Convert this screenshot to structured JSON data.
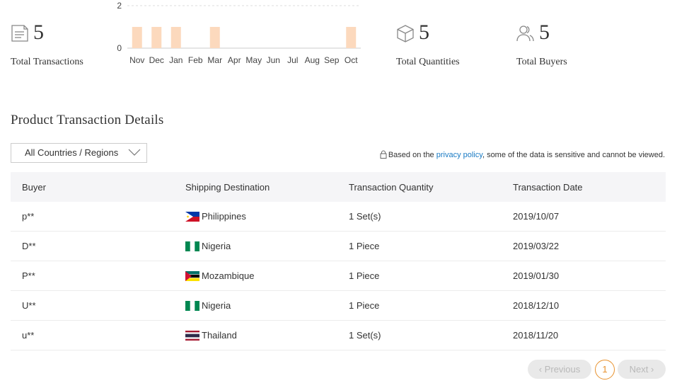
{
  "stats": {
    "transactions": {
      "value": "5",
      "label": "Total Transactions",
      "icon": "document-icon"
    },
    "quantities": {
      "value": "5",
      "label": "Total Quantities",
      "icon": "box-icon"
    },
    "buyers": {
      "value": "5",
      "label": "Total Buyers",
      "icon": "users-icon"
    }
  },
  "chart_data": {
    "type": "bar",
    "categories": [
      "Nov",
      "Dec",
      "Jan",
      "Feb",
      "Mar",
      "Apr",
      "May",
      "Jun",
      "Jul",
      "Aug",
      "Sep",
      "Oct"
    ],
    "values": [
      1,
      1,
      1,
      0,
      1,
      0,
      0,
      0,
      0,
      0,
      0,
      1
    ],
    "yticks": [
      "0",
      "2"
    ],
    "ylim": [
      0,
      2
    ],
    "bar_color": "#fcd9bd",
    "grid": true
  },
  "section_title": "Product Transaction Details",
  "filter": {
    "selected": "All Countries / Regions"
  },
  "privacy": {
    "prefix": "Based on the ",
    "link": "privacy policy",
    "suffix": ", some of the data is sensitive and cannot be viewed."
  },
  "table": {
    "headers": [
      "Buyer",
      "Shipping Destination",
      "Transaction Quantity",
      "Transaction Date"
    ],
    "rows": [
      {
        "buyer": "p**",
        "country": "Philippines",
        "flag": "philippines",
        "quantity": "1 Set(s)",
        "date": "2019/10/07"
      },
      {
        "buyer": "D**",
        "country": "Nigeria",
        "flag": "nigeria",
        "quantity": "1 Piece",
        "date": "2019/03/22"
      },
      {
        "buyer": "P**",
        "country": "Mozambique",
        "flag": "mozambique",
        "quantity": "1 Piece",
        "date": "2019/01/30"
      },
      {
        "buyer": "U**",
        "country": "Nigeria",
        "flag": "nigeria",
        "quantity": "1 Piece",
        "date": "2018/12/10"
      },
      {
        "buyer": "u**",
        "country": "Thailand",
        "flag": "thailand",
        "quantity": "1 Set(s)",
        "date": "2018/11/20"
      }
    ]
  },
  "pagination": {
    "previous": "Previous",
    "page": "1",
    "next": "Next"
  },
  "colors": {
    "accent": "#e8922e",
    "link": "#1a7bc4"
  }
}
